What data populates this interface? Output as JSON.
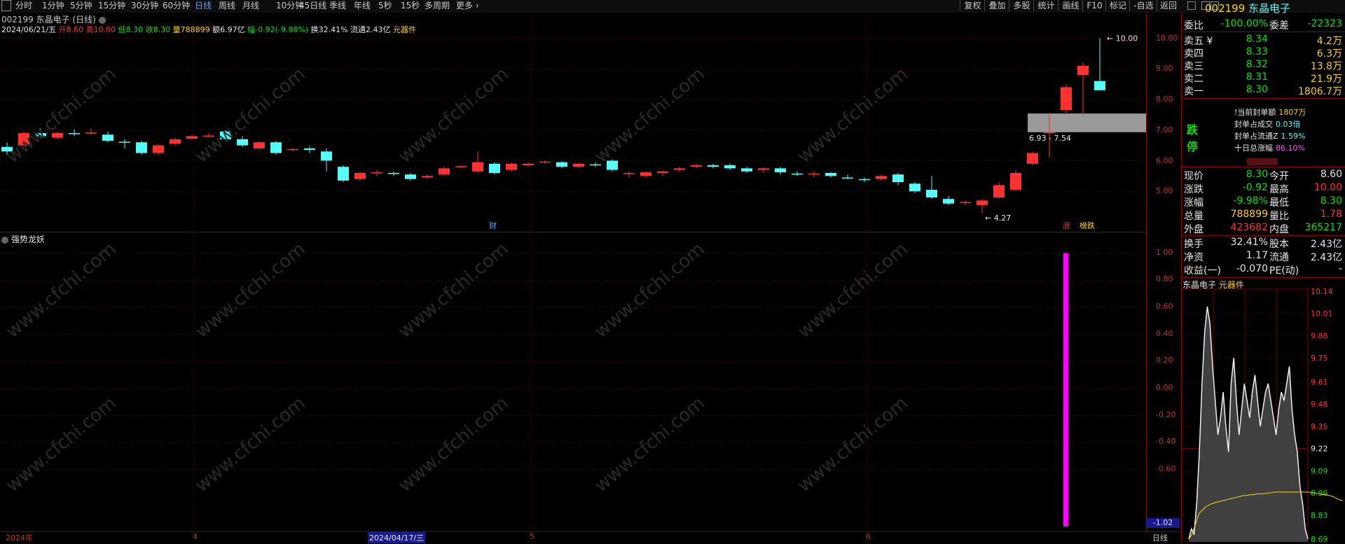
{
  "toolbar": {
    "periods": [
      "分时",
      "1分钟",
      "5分钟",
      "15分钟",
      "30分钟",
      "60分钟",
      "日线",
      "周线",
      "月线",
      "10分钟",
      "45日线",
      "季线",
      "年线",
      "5秒",
      "15秒",
      "多周期",
      "更多"
    ],
    "active_period": "日线",
    "right_buttons": [
      "复权",
      "叠加",
      "多股",
      "统计",
      "画线",
      "F10",
      "标记",
      "-自选",
      "返回"
    ]
  },
  "main": {
    "stock_title": "002199 东晶电子 (日线)",
    "info_date": "2024/06/21/五",
    "info_open_label": "开",
    "info_open": "8.60",
    "info_high_label": "高",
    "info_high": "10.00",
    "info_low_label": "低",
    "info_low": "8.30",
    "info_close_label": "收",
    "info_close": "8.30",
    "info_vol_label": "量",
    "info_vol": "788899",
    "info_amount": "额6.97亿",
    "info_change": "幅-0.92(-9.98%)",
    "info_turnover": "换32.41%",
    "info_float": "流通2.43亿",
    "info_sector": "元器件",
    "range_label": "6.93 - 7.54",
    "max_label": "10.00",
    "min_label": "4.27",
    "marker_cai": "财",
    "marker_zhang": "涨",
    "marker_zhangdie": "榜跌"
  },
  "indicator": {
    "name": "强势龙妖",
    "current_value": "-1.02"
  },
  "price_axis": [
    "10.00",
    "9.00",
    "8.00",
    "7.00",
    "6.00",
    "5.00"
  ],
  "ind_axis": [
    "1.00",
    "0.80",
    "0.60",
    "0.40",
    "0.20",
    "0.00",
    "-0.20",
    "-0.40",
    "-0.60"
  ],
  "dates": [
    "2024年",
    "4",
    "2024/04/17/三",
    "5",
    "6"
  ],
  "bottom_right": "日线",
  "right": {
    "code": "002199",
    "name": "东晶电子",
    "weibi_label": "委比",
    "weibi_value": "-100.00%",
    "weicha_label": "委差",
    "weicha_value": "-22323",
    "asks": [
      {
        "label": "卖五 ¥",
        "price": "8.34",
        "vol": "4.2万"
      },
      {
        "label": "卖四",
        "price": "8.33",
        "vol": "6.3万"
      },
      {
        "label": "卖三",
        "price": "8.32",
        "vol": "13.8万"
      },
      {
        "label": "卖二",
        "price": "8.31",
        "vol": "21.9万"
      },
      {
        "label": "卖一",
        "price": "8.30",
        "vol": "1806.7万"
      }
    ],
    "status": "跌停",
    "seal_items": [
      {
        "label": "!当前封单额",
        "value": "1807万"
      },
      {
        "label": "封单占成交",
        "value": "0.03倍"
      },
      {
        "label": "封单占流通Z",
        "value": "1.59%"
      },
      {
        "label": "十日总涨幅",
        "value": "86.10%"
      }
    ],
    "quote": [
      {
        "l1": "现价",
        "v1": "8.30",
        "l2": "今开",
        "v2": "8.60"
      },
      {
        "l1": "涨跌",
        "v1": "-0.92",
        "l2": "最高",
        "v2": "10.00"
      },
      {
        "l1": "涨幅",
        "v1": "-9.98%",
        "l2": "最低",
        "v2": "8.30"
      },
      {
        "l1": "总量",
        "v1": "788899",
        "l2": "量比",
        "v2": "1.78"
      },
      {
        "l1": "外盘",
        "v1": "423682",
        "l2": "内盘",
        "v2": "365217"
      }
    ],
    "fund": [
      {
        "l1": "换手",
        "v1": "32.41%",
        "l2": "股本",
        "v2": "2.43亿"
      },
      {
        "l1": "净资",
        "v1": "1.17",
        "l2": "流通",
        "v2": "2.43亿"
      },
      {
        "l1": "收益(一)",
        "v1": "-0.070",
        "l2": "PE(动)",
        "v2": "-"
      }
    ],
    "mini_title": "东晶电子",
    "mini_sector": "元器件",
    "mini_axis": [
      "10.14",
      "10.01",
      "9.88",
      "9.75",
      "9.61",
      "9.48",
      "9.35",
      "9.22",
      "9.09",
      "8.96",
      "8.83",
      "8.69"
    ]
  },
  "watermark": "www.cfchi.com",
  "colors": {
    "up": "#ff3232",
    "down": "#54fcfc",
    "indicator": "#ff00ff",
    "grid": "#5a0000"
  },
  "chart_data": {
    "type": "candlestick",
    "candles": [
      [
        6.45,
        6.3,
        6.6,
        6.2
      ],
      [
        6.5,
        6.9,
        6.95,
        6.45
      ],
      [
        6.9,
        6.8,
        7.05,
        6.75
      ],
      [
        6.75,
        6.9,
        6.95,
        6.7
      ],
      [
        6.9,
        6.88,
        7.02,
        6.8
      ],
      [
        6.9,
        6.92,
        7.05,
        6.85
      ],
      [
        6.85,
        6.65,
        6.95,
        6.6
      ],
      [
        6.62,
        6.6,
        6.7,
        6.4
      ],
      [
        6.6,
        6.25,
        6.65,
        6.2
      ],
      [
        6.25,
        6.5,
        6.55,
        6.2
      ],
      [
        6.55,
        6.7,
        6.75,
        6.5
      ],
      [
        6.72,
        6.8,
        6.85,
        6.7
      ],
      [
        6.8,
        6.82,
        6.9,
        6.75
      ],
      [
        6.95,
        6.7,
        7.0,
        6.65
      ],
      [
        6.7,
        6.5,
        6.8,
        6.45
      ],
      [
        6.4,
        6.6,
        6.65,
        6.35
      ],
      [
        6.6,
        6.25,
        6.65,
        6.2
      ],
      [
        6.35,
        6.38,
        6.42,
        6.3
      ],
      [
        6.4,
        6.35,
        6.48,
        6.25
      ],
      [
        6.3,
        6.0,
        6.4,
        5.65
      ],
      [
        5.8,
        5.35,
        5.85,
        5.3
      ],
      [
        5.4,
        5.6,
        5.65,
        5.35
      ],
      [
        5.6,
        5.62,
        5.7,
        5.5
      ],
      [
        5.6,
        5.58,
        5.65,
        5.5
      ],
      [
        5.55,
        5.4,
        5.6,
        5.35
      ],
      [
        5.45,
        5.5,
        5.55,
        5.4
      ],
      [
        5.55,
        5.75,
        5.8,
        5.5
      ],
      [
        5.8,
        5.82,
        5.85,
        5.75
      ],
      [
        5.65,
        5.95,
        6.3,
        5.6
      ],
      [
        5.9,
        5.6,
        5.95,
        5.55
      ],
      [
        5.7,
        5.9,
        5.95,
        5.65
      ],
      [
        5.85,
        5.9,
        5.92,
        5.8
      ],
      [
        5.95,
        5.97,
        6.02,
        5.9
      ],
      [
        5.95,
        5.8,
        5.98,
        5.75
      ],
      [
        5.8,
        5.9,
        5.92,
        5.75
      ],
      [
        5.88,
        5.85,
        5.95,
        5.8
      ],
      [
        6.0,
        5.7,
        6.05,
        5.65
      ],
      [
        5.6,
        5.6,
        5.65,
        5.45
      ],
      [
        5.5,
        5.62,
        5.65,
        5.45
      ],
      [
        5.6,
        5.65,
        5.7,
        5.5
      ],
      [
        5.7,
        5.75,
        5.8,
        5.65
      ],
      [
        5.8,
        5.85,
        5.9,
        5.75
      ],
      [
        5.85,
        5.8,
        5.9,
        5.75
      ],
      [
        5.85,
        5.75,
        5.9,
        5.7
      ],
      [
        5.75,
        5.65,
        5.8,
        5.6
      ],
      [
        5.7,
        5.75,
        5.78,
        5.6
      ],
      [
        5.75,
        5.62,
        5.8,
        5.55
      ],
      [
        5.58,
        5.55,
        5.65,
        5.5
      ],
      [
        5.55,
        5.58,
        5.65,
        5.45
      ],
      [
        5.6,
        5.5,
        5.62,
        5.45
      ],
      [
        5.45,
        5.42,
        5.55,
        5.4
      ],
      [
        5.4,
        5.38,
        5.45,
        5.3
      ],
      [
        5.4,
        5.5,
        5.55,
        5.35
      ],
      [
        5.55,
        5.3,
        5.6,
        5.2
      ],
      [
        5.25,
        5.0,
        5.3,
        4.95
      ],
      [
        5.05,
        4.8,
        5.5,
        4.75
      ],
      [
        4.75,
        4.6,
        4.85,
        4.55
      ],
      [
        4.62,
        4.65,
        4.7,
        4.55
      ],
      [
        4.55,
        4.7,
        4.75,
        4.27
      ],
      [
        4.8,
        5.2,
        5.3,
        4.75
      ],
      [
        5.05,
        5.6,
        5.7,
        5.0
      ],
      [
        5.9,
        6.25,
        6.3,
        5.85
      ],
      [
        6.9,
        6.93,
        7.54,
        6.1
      ],
      [
        7.65,
        8.4,
        8.5,
        7.5
      ],
      [
        8.8,
        9.1,
        9.2,
        7.5
      ],
      [
        8.6,
        8.3,
        10.0,
        8.3
      ]
    ],
    "indicator_bars": [
      {
        "index": 63,
        "value": 1.0,
        "base": -1.02
      }
    ],
    "price_range": [
      4.0,
      10.4
    ],
    "indicator_range": [
      -1.02,
      1.05
    ],
    "mini_series": [
      8.69,
      8.75,
      8.72,
      8.9,
      9.2,
      9.6,
      9.9,
      10.05,
      9.95,
      9.7,
      9.5,
      9.3,
      9.4,
      9.55,
      9.35,
      9.2,
      9.6,
      9.75,
      9.5,
      9.3,
      9.45,
      9.6,
      9.5,
      9.4,
      9.55,
      9.65,
      9.5,
      9.35,
      9.45,
      9.55,
      9.6,
      9.5,
      9.4,
      9.3,
      9.45,
      9.55,
      9.5,
      9.6,
      9.7,
      9.45,
      9.3,
      9.2,
      9.0,
      8.9,
      8.75,
      8.69
    ],
    "mini_avg": [
      8.69,
      8.72,
      8.78,
      8.84,
      8.86,
      8.88,
      8.89,
      8.9,
      8.905,
      8.91,
      8.915,
      8.92,
      8.925,
      8.93,
      8.935,
      8.94,
      8.945,
      8.945,
      8.95,
      8.95,
      8.955,
      8.955,
      8.955,
      8.96,
      8.96,
      8.965,
      8.965,
      8.965,
      8.965,
      8.965,
      8.965,
      8.965,
      8.965,
      8.965,
      8.965,
      8.965,
      8.96,
      8.96,
      8.955,
      8.95,
      8.95,
      8.945,
      8.94,
      8.93,
      8.92,
      8.915
    ]
  }
}
